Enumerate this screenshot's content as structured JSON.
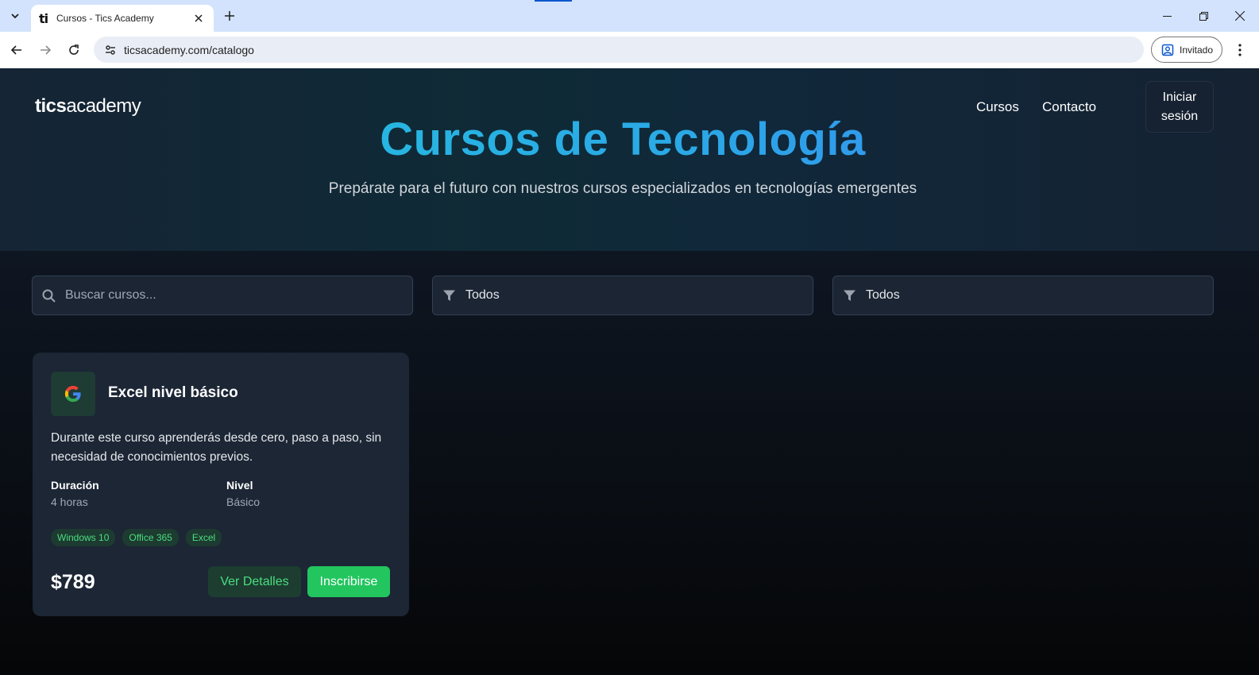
{
  "browser": {
    "tab_title": "Cursos - Tics Academy",
    "tab_favicon": "ti",
    "url": "ticsacademy.com/catalogo",
    "profile_label": "Invitado"
  },
  "site": {
    "logo_bold": "tics",
    "logo_rest": "academy",
    "nav": {
      "courses": "Cursos",
      "contact": "Contacto"
    },
    "login": "Iniciar sesión"
  },
  "hero": {
    "title": "Cursos de Tecnología",
    "subtitle": "Prepárate para el futuro con nuestros cursos especializados en tecnologías emergentes"
  },
  "filters": {
    "search_placeholder": "Buscar cursos...",
    "filter1": "Todos",
    "filter2": "Todos"
  },
  "course": {
    "icon": "google-g-icon",
    "title": "Excel nivel básico",
    "description": "Durante este curso aprenderás desde cero, paso a paso, sin necesidad de conocimientos previos.",
    "duration_label": "Duración",
    "duration_value": "4 horas",
    "level_label": "Nivel",
    "level_value": "Básico",
    "tags": [
      "Windows 10",
      "Office 365",
      "Excel"
    ],
    "price": "$789",
    "details_button": "Ver Detalles",
    "enroll_button": "Inscribirse"
  },
  "colors": {
    "accent_green": "#22c55e",
    "title_gradient_start": "#22c6dc",
    "title_gradient_end": "#3b82f6",
    "page_bg": "#0e1622",
    "card_bg": "#1c2635"
  }
}
